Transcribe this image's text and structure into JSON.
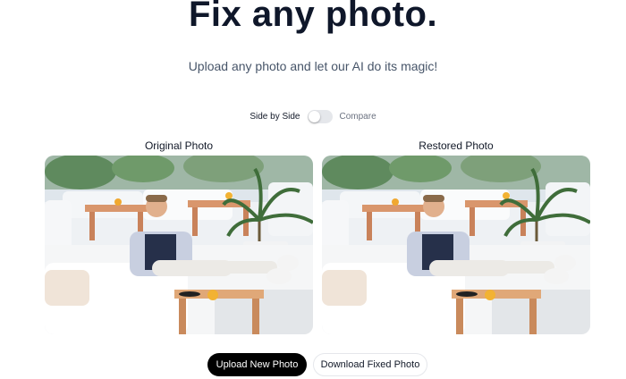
{
  "hero": {
    "title": "Fix any photo.",
    "subtitle": "Upload any photo and let our AI do its magic!"
  },
  "view_toggle": {
    "left_label": "Side by Side",
    "right_label": "Compare",
    "is_on": false
  },
  "panels": {
    "original": {
      "label": "Original Photo"
    },
    "restored": {
      "label": "Restored Photo"
    }
  },
  "actions": {
    "upload_label": "Upload New Photo",
    "download_label": "Download Fixed Photo"
  },
  "colors": {
    "text_dark": "#0f172a",
    "button_dark": "#000000",
    "toggle_off": "#e5e7eb"
  }
}
